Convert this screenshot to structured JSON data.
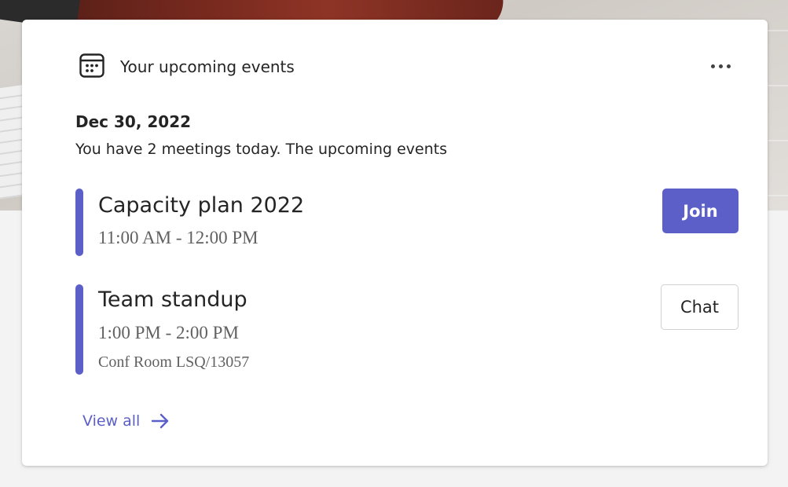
{
  "card": {
    "header": {
      "title": "Your upcoming events",
      "calendar_icon": "calendar-icon",
      "more_icon": "more-horizontal-icon"
    },
    "date": "Dec 30, 2022",
    "summary": "You have 2 meetings today. The upcoming events",
    "events": [
      {
        "title": "Capacity plan 2022",
        "time": "11:00 AM - 12:00 PM",
        "location": "",
        "action_label": "Join"
      },
      {
        "title": "Team standup",
        "time": "1:00 PM - 2:00 PM",
        "location": "Conf Room LSQ/13057",
        "action_label": "Chat"
      }
    ],
    "view_all_label": "View all",
    "view_all_icon": "arrow-right-icon"
  },
  "colors": {
    "accent": "#5b5fc7",
    "text_primary": "#242424",
    "text_secondary": "#616161",
    "card_background": "#ffffff",
    "page_background": "#f3f3f3"
  }
}
